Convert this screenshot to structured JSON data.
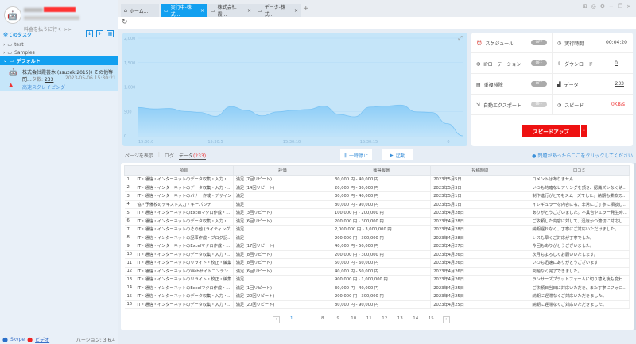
{
  "sidebar": {
    "pay_link": "料金を払うに行く >>",
    "tasks_header": "全てのタスク",
    "tree": [
      {
        "label": "test"
      },
      {
        "label": "Samples"
      },
      {
        "label": "デフォルト"
      }
    ],
    "task": {
      "title": "株式会社霞芸木 (ssuzeki2015)) その他専門...",
      "data_label": "データ数:",
      "data_count": "233",
      "date": "2023-05-06 15:30:21",
      "mode": "高速スクレイピング"
    },
    "footer": {
      "skype": "Skype",
      "video": "ビデオ",
      "version": "バージョン: 3.6.4"
    }
  },
  "tabs": [
    {
      "label": "ホーム..."
    },
    {
      "label": "実行中-株式..."
    },
    {
      "label": "株式会社霞..."
    },
    {
      "label": "データ-株式..."
    }
  ],
  "stats": {
    "schedule": "スケジュール",
    "ip": "IPローテーション",
    "dedupe": "重複排除",
    "export": "自動エクスポート",
    "off": "OFF",
    "runtime_label": "実行時間",
    "runtime": "00:04:20",
    "download_label": "ダウンロード",
    "download": "0",
    "data_label": "データ",
    "data": "233",
    "speed_label": "スピード",
    "speed": "0KB/s",
    "speedup": "スピードアップ"
  },
  "subtabs": {
    "page": "ページを表示",
    "log": "ログ",
    "data": "データ",
    "count": "(233)"
  },
  "controls": {
    "pause": "一時停止",
    "start": "起動",
    "help": "問題があったらここをクリックしてください"
  },
  "table": {
    "headers": [
      "",
      "項目",
      "評価",
      "獲得報酬",
      "投稿時間",
      "口コミ"
    ],
    "rows": [
      [
        "1",
        "IT・通信・インターネットのデータ収集・入力・リス...",
        "満足 (7回リピート)",
        "30,000 円 - 40,000 円",
        "2023年5月5日",
        "コメントはありません"
      ],
      [
        "2",
        "IT・通信・インターネットのデータ収集・入力・リス...",
        "満足 (14回リピート)",
        "20,000 円 - 30,000 円",
        "2023年5月3日",
        "いつも的確なヒアリングを頂き、認識ズレなく納品..."
      ],
      [
        "3",
        "IT・通信・インターネットのバナー作成・デザイン",
        "満足",
        "30,000 円 - 40,000 円",
        "2023年5月1日",
        "制作進行がとてもスムーズでした。納期も柔軟のご..."
      ],
      [
        "4",
        "協・予備校のテキスト入力・キーパンチ",
        "満足",
        "80,000 円 - 90,000 円",
        "2023年5月1日",
        "イレギュラーな内容にも、非常にご丁寧に相談しな..."
      ],
      [
        "5",
        "IT・通信・インターネットのExcelマクロ作成・VBA...",
        "満足 (3回リピート)",
        "100,000 円 - 200,000 円",
        "2023年4月28日",
        "ありがとうございました。不具合やエラー発生時は..."
      ],
      [
        "6",
        "IT・通信・インターネットのデータ収集・入力・リス...",
        "満足 (6回リピート)",
        "200,000 円 - 300,000 円",
        "2023年4月28日",
        "ご依頼した内容に対して、迅速かつ適切に対応して..."
      ],
      [
        "7",
        "IT・通信・インターネットのその他 (ライティング)",
        "満足",
        "2,000,000 円 - 3,000,000 円",
        "2023年4月28日",
        "納期遅れなく、丁寧にご対応いただけました。"
      ],
      [
        "8",
        "IT・通信・インターネットの記事作成・ブログ記事・...",
        "満足",
        "200,000 円 - 300,000 円",
        "2023年4月28日",
        "レスも早くご対応が丁寧でした。"
      ],
      [
        "9",
        "IT・通信・インターネットのExcelマクロ作成・VBA...",
        "満足 (17回リピート)",
        "40,000 円 - 50,000 円",
        "2023年4月27日",
        "今回もありがとうございました。"
      ],
      [
        "10",
        "IT・通信・インターネットのデータ収集・入力・リス...",
        "満足 (8回リピート)",
        "200,000 円 - 300,000 円",
        "2023年4月26日",
        "次月もよろしくお願いいたします。"
      ],
      [
        "11",
        "IT・通信・インターネットのリライト・校正・編集",
        "満足 (8回リピート)",
        "50,000 円 - 60,000 円",
        "2023年4月26日",
        "いつも迅速にありがとうございます!"
      ],
      [
        "12",
        "IT・通信・インターネットのWebサイトコンテンツ作...",
        "満足 (6回リピート)",
        "40,000 円 - 50,000 円",
        "2023年4月26日",
        "問題なく完了できました。"
      ],
      [
        "13",
        "IT・通信・インターネットのリライト・校正・編集",
        "満足",
        "900,000 円 - 1,000,000 円",
        "2023年4月26日",
        "ランサーズプラットフォームに切り替え後も変わら..."
      ],
      [
        "14",
        "IT・通信・インターネットのExcelマクロ作成・VBA...",
        "満足 (1回リピート)",
        "30,000 円 - 40,000 円",
        "2023年4月25日",
        "ご依頼日当日に対応いただき、また丁寧にフォロー..."
      ],
      [
        "15",
        "IT・通信・インターネットのデータ収集・入力・リス...",
        "満足 (20回リピート)",
        "200,000 円 - 300,000 円",
        "2023年4月25日",
        "納期に遅滞なくご対応いただきました。"
      ],
      [
        "16",
        "IT・通信・インターネットのデータ収集・入力・リス...",
        "満足 (20回リピート)",
        "80,000 円 - 90,000 円",
        "2023年4月25日",
        "納期に遅滞なくご対応いただきました。"
      ]
    ]
  },
  "pagination": [
    "1",
    "...",
    "8",
    "9",
    "10",
    "11",
    "12",
    "13",
    "14",
    "15"
  ],
  "chart_data": {
    "type": "area",
    "ylim": [
      0,
      2000
    ],
    "yticks": [
      "0",
      "500",
      "1,000",
      "1,500",
      "2,000"
    ],
    "xticks": [
      "15:30:0",
      "15:30:5",
      "15:30:10",
      "15:30:15",
      "0"
    ],
    "values": [
      580,
      550,
      560,
      500,
      480,
      400,
      600,
      520,
      410,
      490,
      520,
      540,
      610,
      440,
      390,
      590,
      610,
      630,
      490,
      480,
      250,
      0
    ],
    "color": "#8ccdf7",
    "grid": true
  },
  "colors": {
    "accent": "#12a0f0",
    "danger": "#ee1111"
  }
}
